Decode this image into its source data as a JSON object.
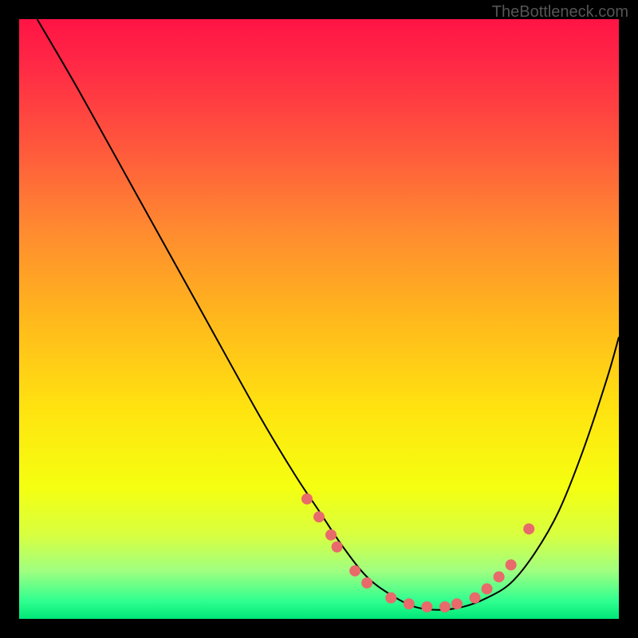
{
  "watermark": "TheBottleneck.com",
  "chart_data": {
    "type": "line",
    "title": "",
    "xlabel": "",
    "ylabel": "",
    "xlim": [
      0,
      100
    ],
    "ylim": [
      0,
      100
    ],
    "series": [
      {
        "name": "curve",
        "x": [
          3,
          10,
          20,
          30,
          40,
          46,
          50,
          54,
          58,
          62,
          66,
          70,
          74,
          78,
          82,
          86,
          90,
          94,
          98,
          100
        ],
        "y": [
          100,
          88,
          70,
          52,
          34,
          24,
          18,
          12,
          7,
          4,
          2,
          1.5,
          2,
          3.5,
          6,
          11,
          18,
          28,
          40,
          47
        ]
      }
    ],
    "markers": {
      "name": "data-points",
      "color": "#e86a6a",
      "x": [
        48,
        50,
        52,
        53,
        56,
        58,
        62,
        65,
        68,
        71,
        73,
        76,
        78,
        80,
        82,
        85
      ],
      "y": [
        20,
        17,
        14,
        12,
        8,
        6,
        3.5,
        2.5,
        2,
        2,
        2.5,
        3.5,
        5,
        7,
        9,
        15
      ]
    }
  }
}
